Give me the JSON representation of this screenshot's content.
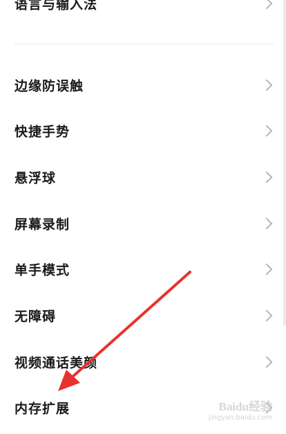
{
  "settings": {
    "items": [
      {
        "label": "语言与输入法"
      },
      {
        "label": "边缘防误触"
      },
      {
        "label": "快捷手势"
      },
      {
        "label": "悬浮球"
      },
      {
        "label": "屏幕录制"
      },
      {
        "label": "单手模式"
      },
      {
        "label": "无障碍"
      },
      {
        "label": "视频通话美颜"
      },
      {
        "label": "内存扩展"
      }
    ]
  },
  "annotation": {
    "arrow_color": "#e8322d"
  },
  "watermark": {
    "main": "Baidu经验",
    "sub": "jingyan.baidu.com"
  }
}
